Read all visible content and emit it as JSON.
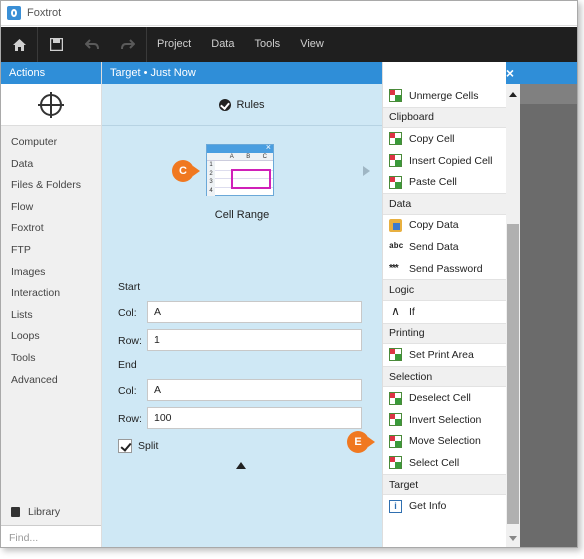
{
  "app": {
    "title": "Foxtrot"
  },
  "menubar": {
    "items": [
      "Project",
      "Data",
      "Tools",
      "View"
    ]
  },
  "left": {
    "header": "Actions",
    "categories": [
      "Computer",
      "Data",
      "Files & Folders",
      "Flow",
      "Foxtrot",
      "FTP",
      "Images",
      "Interaction",
      "Lists",
      "Loops",
      "Tools",
      "Advanced"
    ],
    "library": "Library",
    "find_placeholder": "Find..."
  },
  "mid": {
    "header": "Target  •  Just Now",
    "rules": "Rules",
    "cell_range": {
      "label": "Cell Range",
      "col_headers": [
        "",
        "A",
        "B",
        "C"
      ],
      "row_headers": [
        "1",
        "2",
        "3",
        "4"
      ],
      "badge": "C"
    },
    "start_label": "Start",
    "end_label": "End",
    "col_label": "Col:",
    "row_label": "Row:",
    "start_col": "A",
    "start_row": "1",
    "end_col": "A",
    "end_row": "100",
    "split_label": "Split",
    "split_checked": true
  },
  "right": {
    "badge": "E",
    "items": [
      {
        "type": "item",
        "label": "Unmerge Cells",
        "icon": "cells-icon"
      },
      {
        "type": "cat",
        "label": "Clipboard"
      },
      {
        "type": "item",
        "label": "Copy Cell",
        "icon": "cells-icon"
      },
      {
        "type": "item",
        "label": "Insert Copied Cell",
        "icon": "cells-icon"
      },
      {
        "type": "item",
        "label": "Paste Cell",
        "icon": "cells-icon"
      },
      {
        "type": "cat",
        "label": "Data"
      },
      {
        "type": "item",
        "label": "Copy Data",
        "icon": "copy-data-icon"
      },
      {
        "type": "item",
        "label": "Send Data",
        "icon": "abc-icon"
      },
      {
        "type": "item",
        "label": "Send Password",
        "icon": "password-icon"
      },
      {
        "type": "cat",
        "label": "Logic"
      },
      {
        "type": "item",
        "label": "If",
        "icon": "branch-icon"
      },
      {
        "type": "cat",
        "label": "Printing"
      },
      {
        "type": "item",
        "label": "Set Print Area",
        "icon": "print-area-icon"
      },
      {
        "type": "cat",
        "label": "Selection"
      },
      {
        "type": "item",
        "label": "Deselect Cell",
        "icon": "cells-icon"
      },
      {
        "type": "item",
        "label": "Invert Selection",
        "icon": "cells-icon"
      },
      {
        "type": "item",
        "label": "Move Selection",
        "icon": "cells-icon"
      },
      {
        "type": "item",
        "label": "Select Cell",
        "icon": "cells-icon"
      },
      {
        "type": "cat",
        "label": "Target"
      },
      {
        "type": "item",
        "label": "Get Info",
        "icon": "info-icon"
      }
    ]
  },
  "glyphs": {
    "abc": "abc",
    "password": "***",
    "branch": "∧",
    "info": "i",
    "close": "×"
  }
}
